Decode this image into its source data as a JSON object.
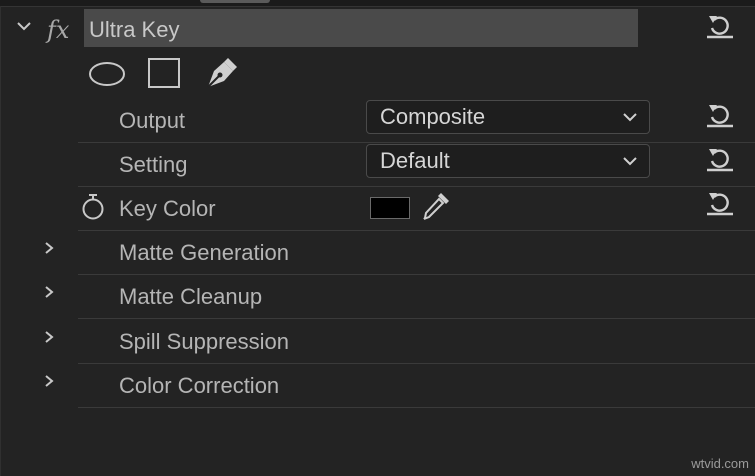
{
  "effect": {
    "fx_label": "fx",
    "name": "Ultra Key"
  },
  "mask_tools": [
    {
      "name": "ellipse-mask-icon"
    },
    {
      "name": "rectangle-mask-icon"
    },
    {
      "name": "pen-mask-icon"
    }
  ],
  "properties": {
    "output": {
      "label": "Output",
      "value": "Composite"
    },
    "setting": {
      "label": "Setting",
      "value": "Default"
    },
    "key_color": {
      "label": "Key Color",
      "swatch_color": "#000000"
    }
  },
  "groups": [
    {
      "label": "Matte Generation"
    },
    {
      "label": "Matte Cleanup"
    },
    {
      "label": "Spill Suppression"
    },
    {
      "label": "Color Correction"
    }
  ],
  "icons": {
    "reset": "reset-icon",
    "stopwatch": "stopwatch-icon",
    "eyedropper": "eyedropper-icon",
    "collapse": "chevron-down-icon",
    "expand": "chevron-right-icon"
  },
  "watermark": "wtvid.com",
  "colors": {
    "panel_bg": "#232323",
    "name_bg": "#4a4a4a",
    "dropdown_bg": "#1e1e1e",
    "icon": "#c8c8c8"
  }
}
